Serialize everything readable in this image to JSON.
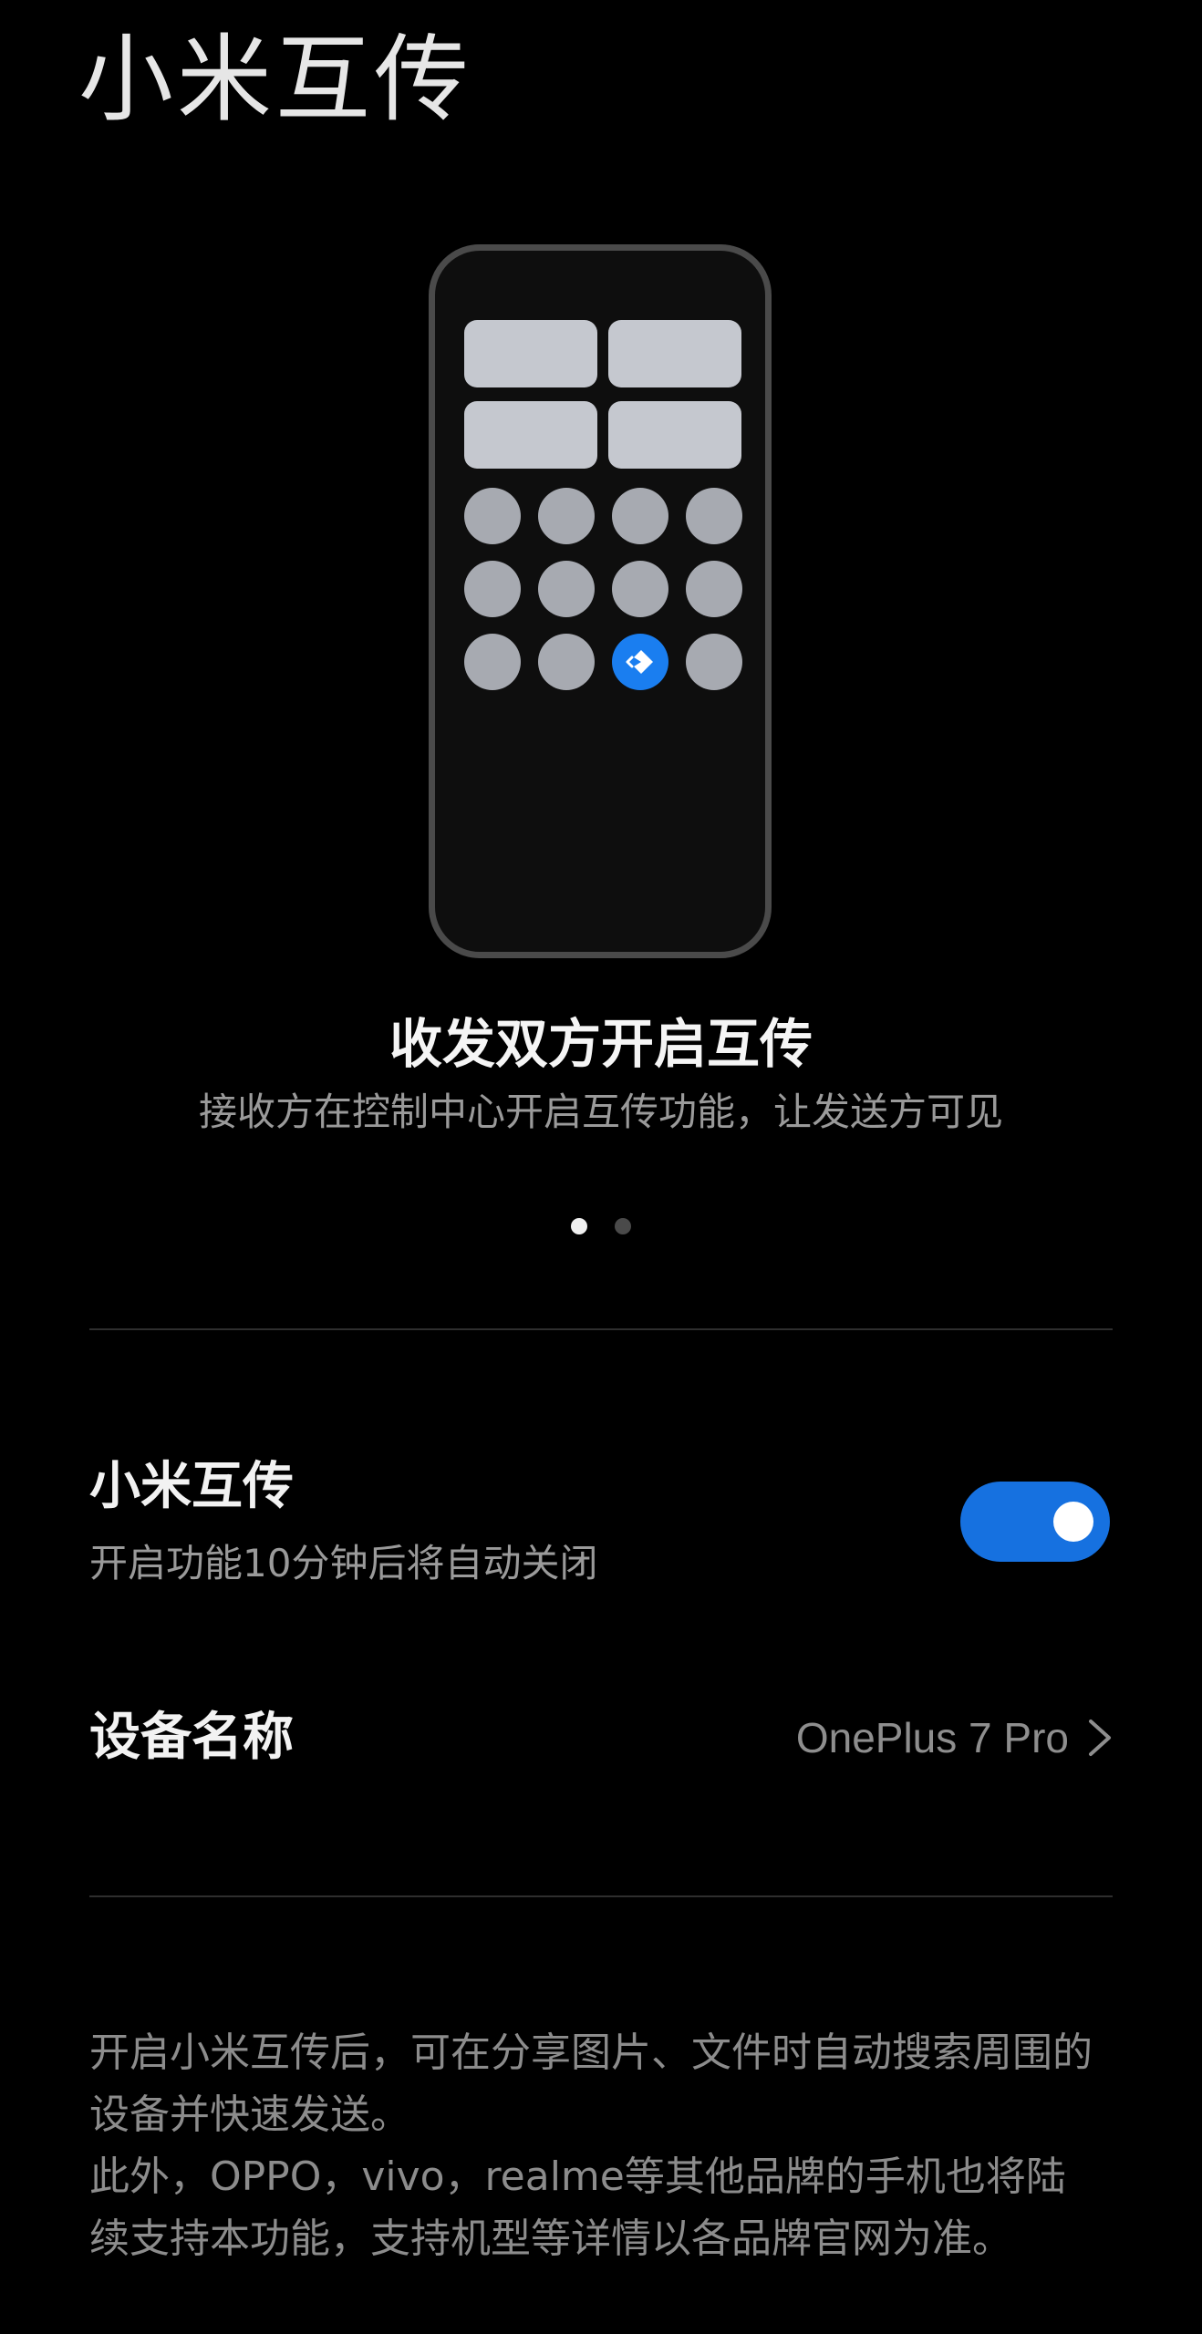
{
  "header": {
    "title": "小米互传"
  },
  "carousel": {
    "title": "收发双方开启互传",
    "subtitle": "接收方在控制中心开启互传功能，让发送方可见",
    "pages": 2,
    "current_page": 1
  },
  "settings": {
    "transfer": {
      "title": "小米互传",
      "subtitle": "开启功能10分钟后将自动关闭",
      "enabled": true
    },
    "device_name": {
      "label": "设备名称",
      "value": "OnePlus 7 Pro"
    }
  },
  "info": {
    "line1": "开启小米互传后，可在分享图片、文件时自动搜索周围的设备并快速发送。",
    "line2": "此外，OPPO，vivo，realme等其他品牌的手机也将陆续支持本功能，支持机型等详情以各品牌官网为准。"
  },
  "colors": {
    "accent": "#1671e0",
    "background": "#000000"
  }
}
